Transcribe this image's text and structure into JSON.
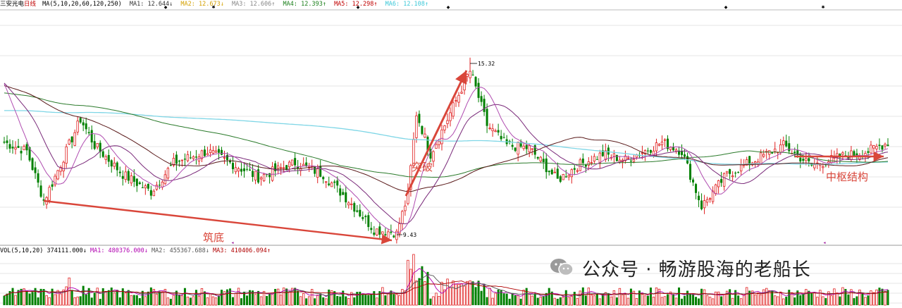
{
  "header": {
    "stock_name": "三安光电",
    "period": "日线",
    "ma_group": "MA(5,10,20,60,120,250)",
    "ma_values": [
      {
        "label": "MA1: 12.644↓",
        "color": "#333333"
      },
      {
        "label": "MA2: 12.673↓",
        "color": "#d4a000"
      },
      {
        "label": "MA3: 12.606↑",
        "color": "#888888"
      },
      {
        "label": "MA4: 12.393↑",
        "color": "#1a7f1a"
      },
      {
        "label": "MA5: 12.298↑",
        "color": "#c00000"
      },
      {
        "label": "MA6: 12.108↑",
        "color": "#3cc8d8"
      }
    ]
  },
  "volume_header": {
    "group": "VOL(5,10,20)",
    "vol": "374111.000↓",
    "ma1": "MA1: 480376.000↓",
    "ma2": "MA2: 455367.688↓",
    "ma3": "MA3: 410406.094↑",
    "colors": {
      "vol": "#000000",
      "ma1": "#b000b0",
      "ma2": "#555555",
      "ma3": "#b00000"
    }
  },
  "price_labels": {
    "high": "15.32",
    "low": "9.43"
  },
  "annotations": {
    "bottoming": "筑底",
    "breakout": "突破",
    "pivot": "中枢结构"
  },
  "watermark": "公众号 · 畅游股海的老船长",
  "colors": {
    "up": "#e02020",
    "down": "#008000",
    "grid": "#e6e6e6",
    "arrow": "#d9463a",
    "ma250": "#7fd6e6",
    "ma120": "#2a7a2a",
    "ma60": "#5a1a1a",
    "ma20": "#7a2a7a",
    "ma10": "#b04cb0"
  },
  "chart_data": {
    "type": "candlestick",
    "series_name": "三安光电 日线",
    "anchors": [
      {
        "bar": 0,
        "price": 12.6
      },
      {
        "bar": 8,
        "price": 12.3
      },
      {
        "bar": 14,
        "price": 10.6
      },
      {
        "bar": 17,
        "price": 11.2
      },
      {
        "bar": 27,
        "price": 13.4
      },
      {
        "bar": 32,
        "price": 12.5
      },
      {
        "bar": 42,
        "price": 11.5
      },
      {
        "bar": 52,
        "price": 10.9
      },
      {
        "bar": 60,
        "price": 11.9
      },
      {
        "bar": 72,
        "price": 12.3
      },
      {
        "bar": 90,
        "price": 11.4
      },
      {
        "bar": 103,
        "price": 11.9
      },
      {
        "bar": 113,
        "price": 11.5
      },
      {
        "bar": 122,
        "price": 10.6
      },
      {
        "bar": 131,
        "price": 9.6
      },
      {
        "bar": 139,
        "price": 9.5
      },
      {
        "bar": 143,
        "price": 10.8
      },
      {
        "bar": 146,
        "price": 13.6
      },
      {
        "bar": 151,
        "price": 12.2
      },
      {
        "bar": 157,
        "price": 13.4
      },
      {
        "bar": 165,
        "price": 15.1
      },
      {
        "bar": 171,
        "price": 13.2
      },
      {
        "bar": 178,
        "price": 12.5
      },
      {
        "bar": 186,
        "price": 12.4
      },
      {
        "bar": 196,
        "price": 11.3
      },
      {
        "bar": 203,
        "price": 11.8
      },
      {
        "bar": 212,
        "price": 12.2
      },
      {
        "bar": 220,
        "price": 12.0
      },
      {
        "bar": 233,
        "price": 12.6
      },
      {
        "bar": 240,
        "price": 12.3
      },
      {
        "bar": 247,
        "price": 10.4
      },
      {
        "bar": 256,
        "price": 11.5
      },
      {
        "bar": 266,
        "price": 12.0
      },
      {
        "bar": 276,
        "price": 12.5
      },
      {
        "bar": 286,
        "price": 11.8
      },
      {
        "bar": 296,
        "price": 12.1
      },
      {
        "bar": 306,
        "price": 12.3
      },
      {
        "bar": 313,
        "price": 12.6
      }
    ],
    "total_bars": 314,
    "price_high": 15.32,
    "price_low": 9.43,
    "moving_averages": [
      5,
      10,
      20,
      60,
      120,
      250
    ],
    "volume_ma": [
      5,
      10,
      20
    ]
  }
}
